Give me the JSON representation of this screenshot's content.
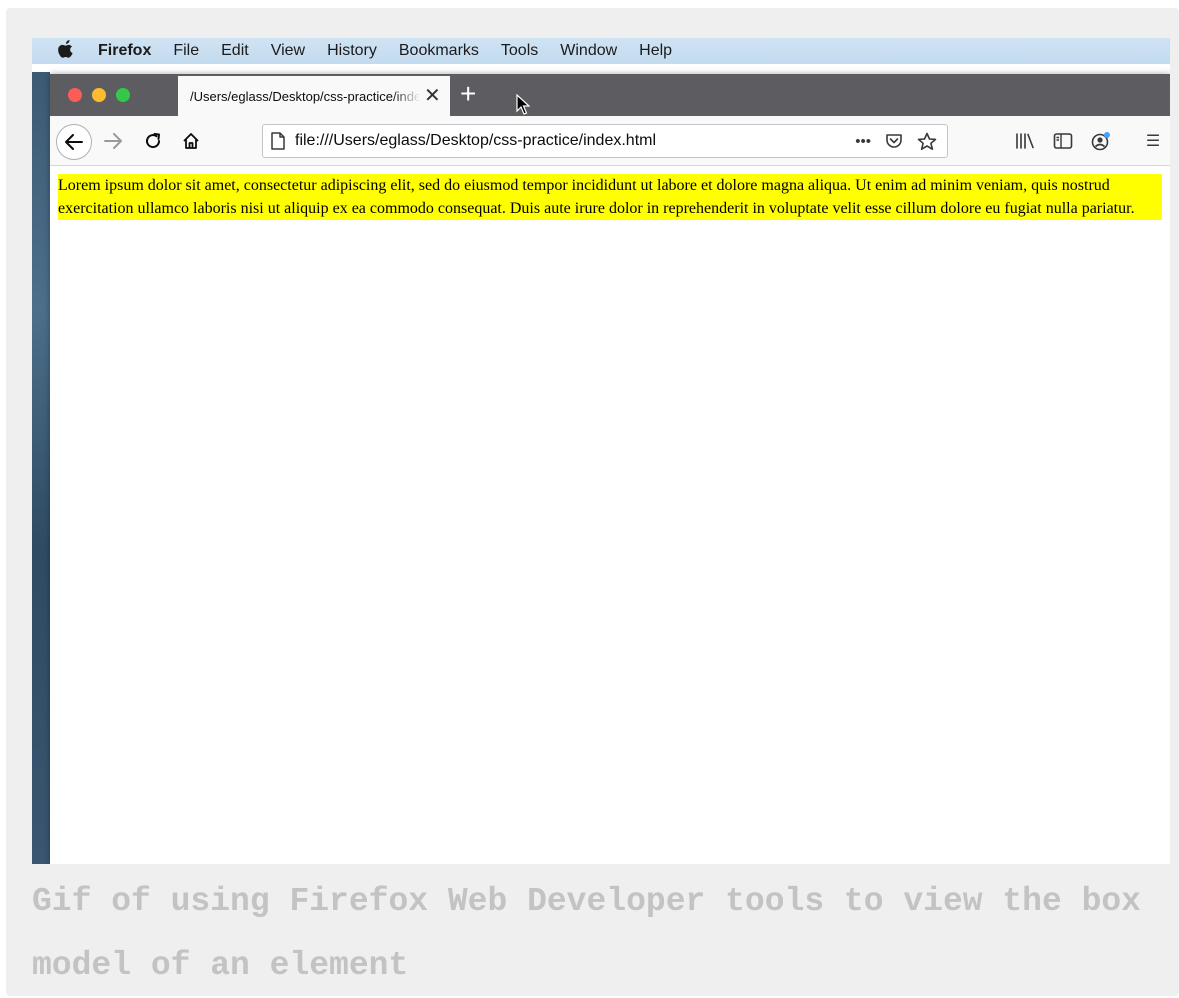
{
  "menubar": {
    "app_name": "Firefox",
    "items": [
      "File",
      "Edit",
      "View",
      "History",
      "Bookmarks",
      "Tools",
      "Window",
      "Help"
    ]
  },
  "tab": {
    "title": "/Users/eglass/Desktop/css-practice/index.html",
    "close_symbol": "✕",
    "new_tab_symbol": "+"
  },
  "urlbar": {
    "url": "file:///Users/eglass/Desktop/css-practice/index.html",
    "page_actions_symbol": "•••"
  },
  "toolbar": {
    "menu_symbol": "☰"
  },
  "content": {
    "paragraph": "Lorem ipsum dolor sit amet, consectetur adipiscing elit, sed do eiusmod tempor incididunt ut labore et dolore magna aliqua. Ut enim ad minim veniam, quis nostrud exercitation ullamco laboris nisi ut aliquip ex ea commodo consequat. Duis aute irure dolor in reprehenderit in voluptate velit esse cillum dolore eu fugiat nulla pariatur.",
    "highlight_color": "#ffff00"
  },
  "caption": "Gif of using Firefox Web Developer tools to view the box model of an element"
}
